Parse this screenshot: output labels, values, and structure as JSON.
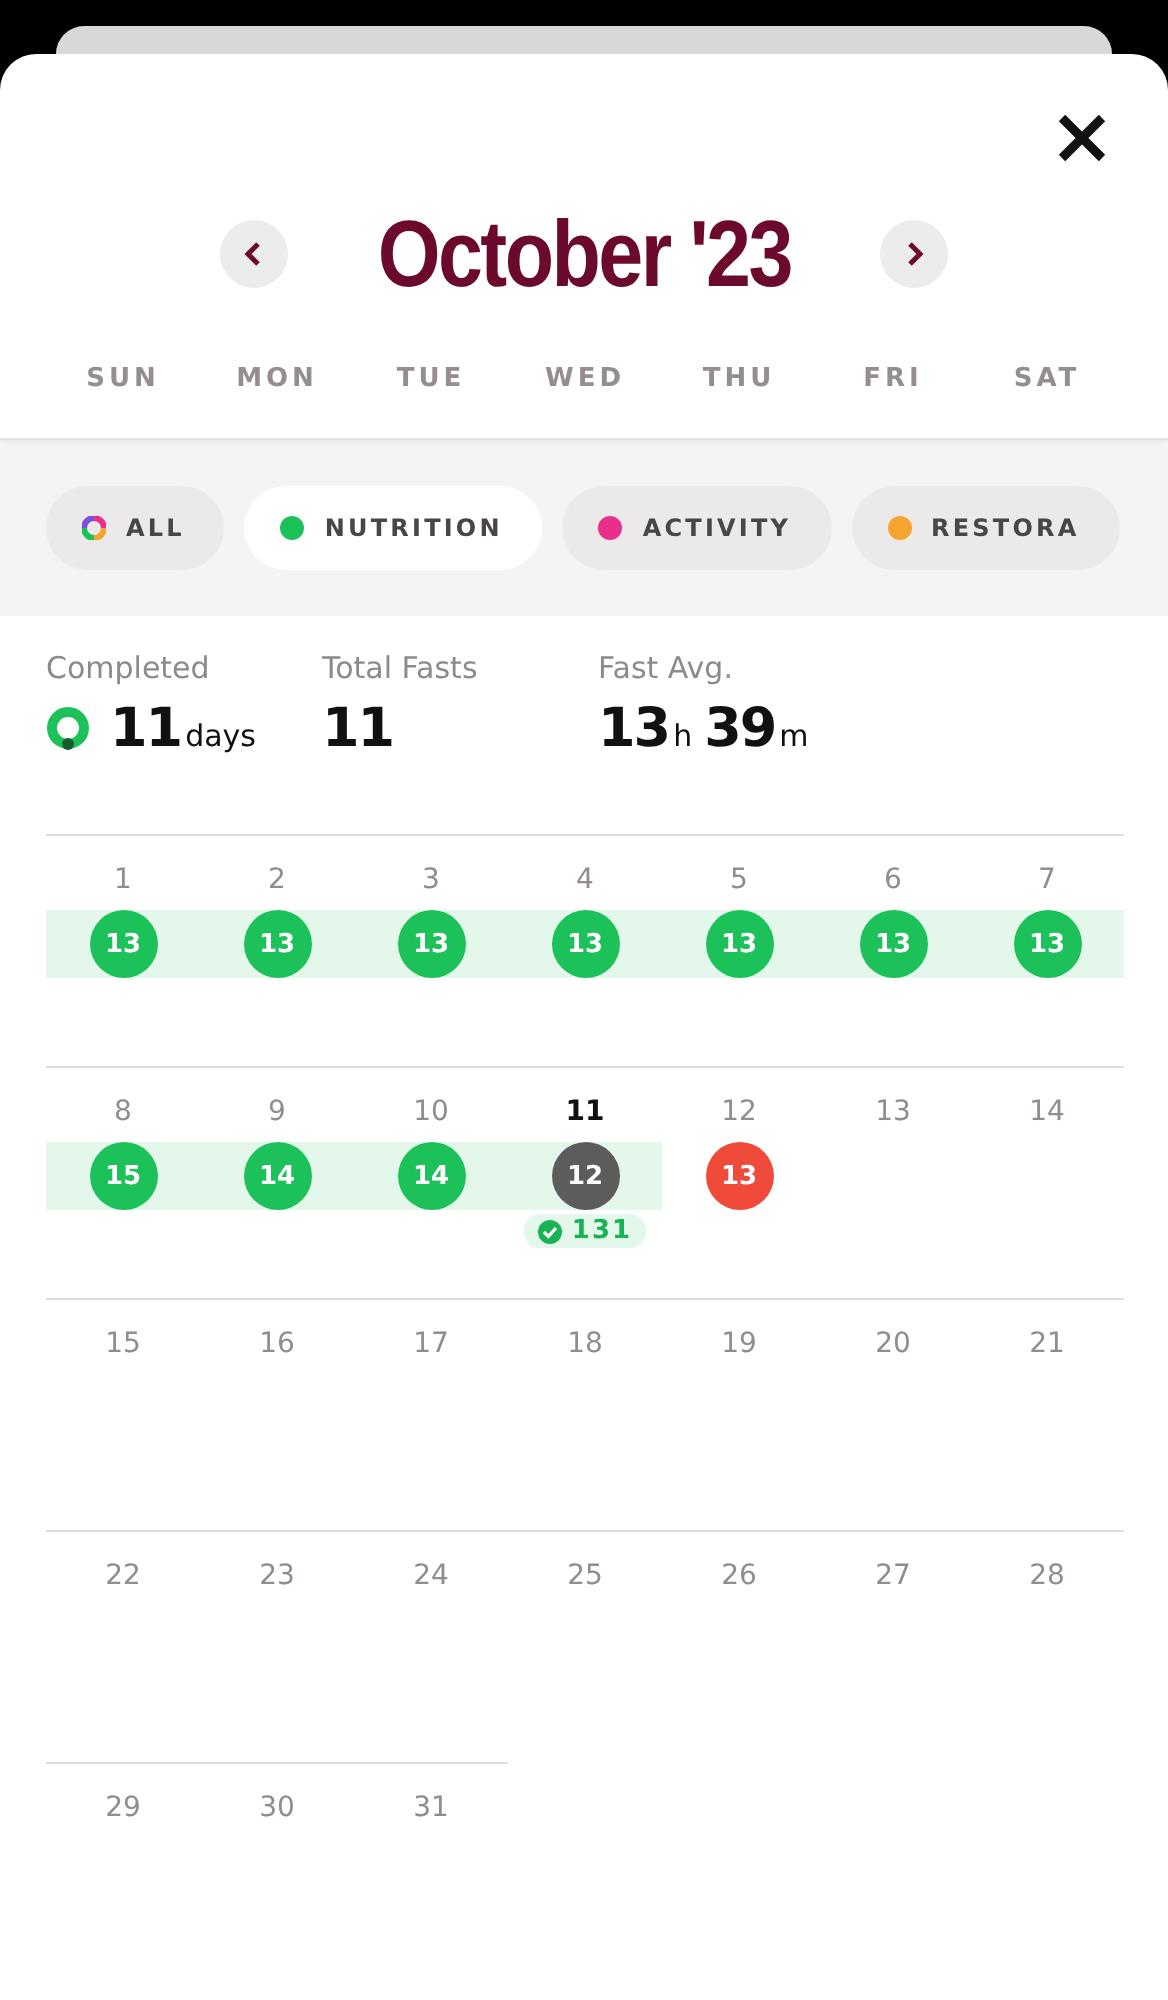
{
  "header": {
    "title": "October '23",
    "weekdays": [
      "SUN",
      "MON",
      "TUE",
      "WED",
      "THU",
      "FRI",
      "SAT"
    ]
  },
  "filters": [
    {
      "label": "ALL",
      "kind": "all",
      "selected": false
    },
    {
      "label": "NUTRITION",
      "kind": "dot",
      "color": "#1dc15a",
      "selected": true
    },
    {
      "label": "ACTIVITY",
      "kind": "dot",
      "color": "#e8308a",
      "selected": false
    },
    {
      "label": "RESTORA",
      "kind": "dot",
      "color": "#f4a52e",
      "selected": false
    }
  ],
  "stats": [
    {
      "label": "Completed",
      "ring": true,
      "parts": [
        {
          "number": "11",
          "unit": "days"
        }
      ]
    },
    {
      "label": "Total Fasts",
      "ring": false,
      "parts": [
        {
          "number": "11"
        }
      ]
    },
    {
      "label": "Fast Avg.",
      "ring": false,
      "parts": [
        {
          "number": "13",
          "unit": "h"
        },
        {
          "number": "39",
          "unit": "m"
        }
      ]
    }
  ],
  "weeks": [
    {
      "days": [
        {
          "number": "1",
          "today": false,
          "streak": true,
          "fast": {
            "hours": "13",
            "color": "#1dc15a"
          }
        },
        {
          "number": "2",
          "today": false,
          "streak": true,
          "fast": {
            "hours": "13",
            "color": "#1dc15a"
          }
        },
        {
          "number": "3",
          "today": false,
          "streak": true,
          "fast": {
            "hours": "13",
            "color": "#1dc15a"
          }
        },
        {
          "number": "4",
          "today": false,
          "streak": true,
          "fast": {
            "hours": "13",
            "color": "#1dc15a"
          }
        },
        {
          "number": "5",
          "today": false,
          "streak": true,
          "fast": {
            "hours": "13",
            "color": "#1dc15a"
          }
        },
        {
          "number": "6",
          "today": false,
          "streak": true,
          "fast": {
            "hours": "13",
            "color": "#1dc15a"
          }
        },
        {
          "number": "7",
          "today": false,
          "streak": true,
          "fast": {
            "hours": "13",
            "color": "#1dc15a"
          }
        }
      ]
    },
    {
      "days": [
        {
          "number": "8",
          "today": false,
          "streak": true,
          "fast": {
            "hours": "15",
            "color": "#1dc15a"
          }
        },
        {
          "number": "9",
          "today": false,
          "streak": true,
          "fast": {
            "hours": "14",
            "color": "#1dc15a"
          }
        },
        {
          "number": "10",
          "today": false,
          "streak": true,
          "fast": {
            "hours": "14",
            "color": "#1dc15a"
          }
        },
        {
          "number": "11",
          "today": true,
          "streak": true,
          "fast": {
            "hours": "12",
            "color": "#5c5c5c"
          },
          "streak_count": "131"
        },
        {
          "number": "12",
          "today": false,
          "streak": false,
          "fast": {
            "hours": "13",
            "color": "#f04a3a"
          }
        },
        {
          "number": "13",
          "today": false,
          "streak": false
        },
        {
          "number": "14",
          "today": false,
          "streak": false
        }
      ]
    },
    {
      "days": [
        {
          "number": "15",
          "today": false,
          "streak": false
        },
        {
          "number": "16",
          "today": false,
          "streak": false
        },
        {
          "number": "17",
          "today": false,
          "streak": false
        },
        {
          "number": "18",
          "today": false,
          "streak": false
        },
        {
          "number": "19",
          "today": false,
          "streak": false
        },
        {
          "number": "20",
          "today": false,
          "streak": false
        },
        {
          "number": "21",
          "today": false,
          "streak": false
        }
      ]
    },
    {
      "days": [
        {
          "number": "22",
          "today": false,
          "streak": false
        },
        {
          "number": "23",
          "today": false,
          "streak": false
        },
        {
          "number": "24",
          "today": false,
          "streak": false
        },
        {
          "number": "25",
          "today": false,
          "streak": false
        },
        {
          "number": "26",
          "today": false,
          "streak": false
        },
        {
          "number": "27",
          "today": false,
          "streak": false
        },
        {
          "number": "28",
          "today": false,
          "streak": false
        }
      ]
    },
    {
      "days": [
        {
          "number": "29",
          "today": false,
          "streak": false
        },
        {
          "number": "30",
          "today": false,
          "streak": false
        },
        {
          "number": "31",
          "today": false,
          "streak": false
        }
      ]
    }
  ]
}
